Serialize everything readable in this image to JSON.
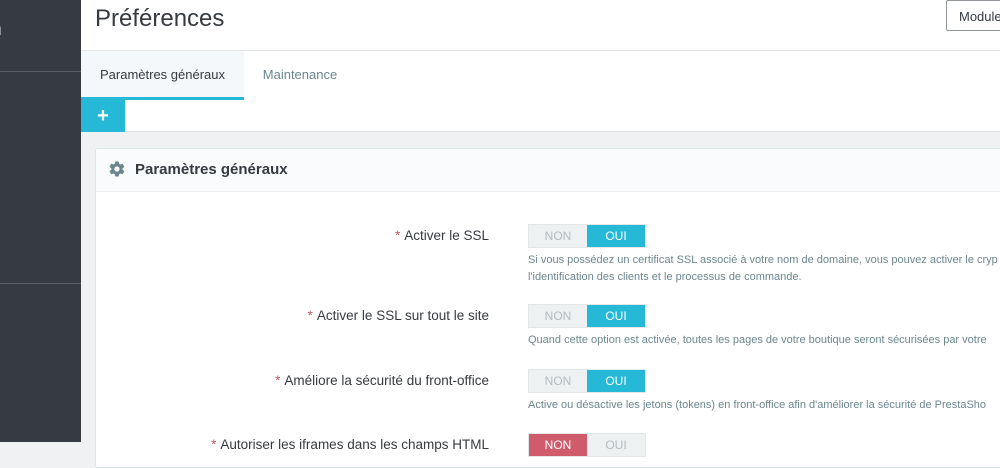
{
  "sidebar": {
    "partial_item_label": "ord"
  },
  "header": {
    "title": "Préférences",
    "modules_button": "Modules"
  },
  "tabs": [
    {
      "label": "Paramètres généraux",
      "active": true
    },
    {
      "label": "Maintenance",
      "active": false
    }
  ],
  "toolbar": {
    "add_label": "+"
  },
  "panel": {
    "title": "Paramètres généraux",
    "icon": "gear-icon",
    "required_mark": "*",
    "fields": [
      {
        "label": "Activer le SSL",
        "off_label": "NON",
        "on_label": "OUI",
        "value": "OUI",
        "help_line1": "Si vous possédez un certificat SSL associé à votre nom de domaine, vous pouvez activer le cryp",
        "help_line2": "l'identification des clients et le processus de commande."
      },
      {
        "label": "Activer le SSL sur tout le site",
        "off_label": "NON",
        "on_label": "OUI",
        "value": "OUI",
        "help_line1": "Quand cette option est activée, toutes les pages de votre boutique seront sécurisées par votre"
      },
      {
        "label": "Améliore la sécurité du front-office",
        "off_label": "NON",
        "on_label": "OUI",
        "value": "OUI",
        "help_line1": "Active ou désactive les jetons (tokens) en front-office afin d'améliorer la sécurité de PrestaSho"
      },
      {
        "label": "Autoriser les iframes dans les champs HTML",
        "off_label": "NON",
        "on_label": "OUI",
        "value": "NON"
      }
    ]
  },
  "colors": {
    "accent": "#25b9d7",
    "danger": "#d05c6b",
    "sidebar": "#363a41"
  }
}
